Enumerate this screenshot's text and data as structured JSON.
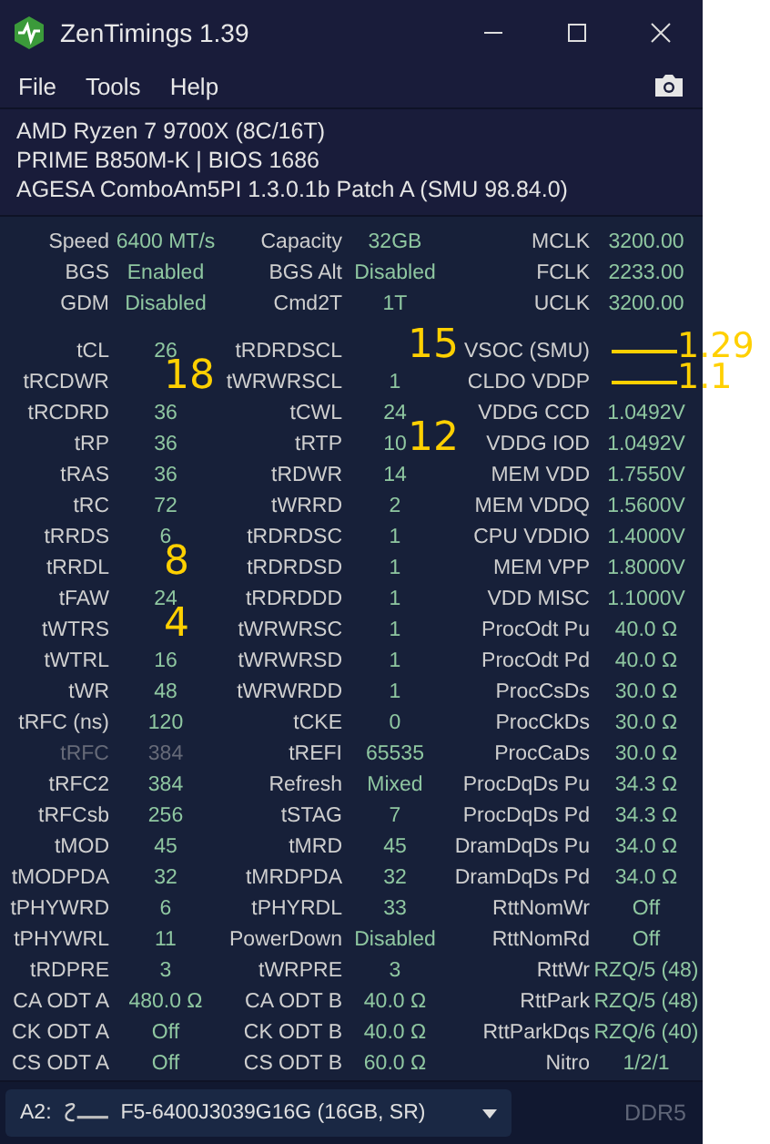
{
  "window": {
    "title": "ZenTimings 1.39"
  },
  "menu": [
    "File",
    "Tools",
    "Help"
  ],
  "system_info": [
    "AMD Ryzen 7 9700X (8C/16T)",
    "PRIME B850M-K | BIOS 1686",
    "AGESA ComboAm5PI 1.3.0.1b Patch A (SMU 98.84.0)"
  ],
  "summary": [
    [
      {
        "label": "Speed",
        "value": "6400 MT/s"
      },
      {
        "label": "Capacity",
        "value": "32GB"
      },
      {
        "label": "MCLK",
        "value": "3200.00"
      }
    ],
    [
      {
        "label": "BGS",
        "value": "Enabled"
      },
      {
        "label": "BGS Alt",
        "value": "Disabled"
      },
      {
        "label": "FCLK",
        "value": "2233.00"
      }
    ],
    [
      {
        "label": "GDM",
        "value": "Disabled"
      },
      {
        "label": "Cmd2T",
        "value": "1T"
      },
      {
        "label": "UCLK",
        "value": "3200.00"
      }
    ]
  ],
  "timings": [
    [
      {
        "label": "tCL",
        "value": "26"
      },
      {
        "label": "tRDRDSCL",
        "annotation": "15"
      },
      {
        "label": "VSOC (SMU)",
        "struck": true,
        "annotation": "1.29"
      }
    ],
    [
      {
        "label": "tRCDWR",
        "annotation": "18"
      },
      {
        "label": "tWRWRSCL",
        "value": "1"
      },
      {
        "label": "CLDO VDDP",
        "struck": true,
        "annotation": "1.1"
      }
    ],
    [
      {
        "label": "tRCDRD",
        "value": "36"
      },
      {
        "label": "tCWL",
        "value": "24"
      },
      {
        "label": "VDDG CCD",
        "value": "1.0492V"
      }
    ],
    [
      {
        "label": "tRP",
        "value": "36"
      },
      {
        "label": "tRTP",
        "value": "10",
        "annotation": "12"
      },
      {
        "label": "VDDG IOD",
        "value": "1.0492V"
      }
    ],
    [
      {
        "label": "tRAS",
        "value": "36"
      },
      {
        "label": "tRDWR",
        "value": "14"
      },
      {
        "label": "MEM VDD",
        "value": "1.7550V"
      }
    ],
    [
      {
        "label": "tRC",
        "value": "72"
      },
      {
        "label": "tWRRD",
        "value": "2"
      },
      {
        "label": "MEM VDDQ",
        "value": "1.5600V"
      }
    ],
    [
      {
        "label": "tRRDS",
        "value": "6"
      },
      {
        "label": "tRDRDSC",
        "value": "1"
      },
      {
        "label": "CPU VDDIO",
        "value": "1.4000V"
      }
    ],
    [
      {
        "label": "tRRDL",
        "annotation": "8"
      },
      {
        "label": "tRDRDSD",
        "value": "1"
      },
      {
        "label": "MEM VPP",
        "value": "1.8000V"
      }
    ],
    [
      {
        "label": "tFAW",
        "value": "24"
      },
      {
        "label": "tRDRDDD",
        "value": "1"
      },
      {
        "label": "VDD MISC",
        "value": "1.1000V"
      }
    ],
    [
      {
        "label": "tWTRS",
        "annotation": "4"
      },
      {
        "label": "tWRWRSC",
        "value": "1"
      },
      {
        "label": "ProcOdt Pu",
        "value": "40.0 Ω"
      }
    ],
    [
      {
        "label": "tWTRL",
        "value": "16"
      },
      {
        "label": "tWRWRSD",
        "value": "1"
      },
      {
        "label": "ProcOdt Pd",
        "value": "40.0 Ω"
      }
    ],
    [
      {
        "label": "tWR",
        "value": "48"
      },
      {
        "label": "tWRWRDD",
        "value": "1"
      },
      {
        "label": "ProcCsDs",
        "value": "30.0 Ω"
      }
    ],
    [
      {
        "label": "tRFC (ns)",
        "value": "120"
      },
      {
        "label": "tCKE",
        "value": "0"
      },
      {
        "label": "ProcCkDs",
        "value": "30.0 Ω"
      }
    ],
    [
      {
        "label": "tRFC",
        "value": "384",
        "disabled": true
      },
      {
        "label": "tREFI",
        "value": "65535"
      },
      {
        "label": "ProcCaDs",
        "value": "30.0 Ω"
      }
    ],
    [
      {
        "label": "tRFC2",
        "value": "384"
      },
      {
        "label": "Refresh",
        "value": "Mixed"
      },
      {
        "label": "ProcDqDs Pu",
        "value": "34.3 Ω"
      }
    ],
    [
      {
        "label": "tRFCsb",
        "value": "256"
      },
      {
        "label": "tSTAG",
        "value": "7"
      },
      {
        "label": "ProcDqDs Pd",
        "value": "34.3 Ω"
      }
    ],
    [
      {
        "label": "tMOD",
        "value": "45"
      },
      {
        "label": "tMRD",
        "value": "45"
      },
      {
        "label": "DramDqDs Pu",
        "value": "34.0 Ω"
      }
    ],
    [
      {
        "label": "tMODPDA",
        "value": "32"
      },
      {
        "label": "tMRDPDA",
        "value": "32"
      },
      {
        "label": "DramDqDs Pd",
        "value": "34.0 Ω"
      }
    ],
    [
      {
        "label": "tPHYWRD",
        "value": "6"
      },
      {
        "label": "tPHYRDL",
        "value": "33"
      },
      {
        "label": "RttNomWr",
        "value": "Off"
      }
    ],
    [
      {
        "label": "tPHYWRL",
        "value": "11"
      },
      {
        "label": "PowerDown",
        "value": "Disabled"
      },
      {
        "label": "RttNomRd",
        "value": "Off"
      }
    ],
    [
      {
        "label": "tRDPRE",
        "value": "3"
      },
      {
        "label": "tWRPRE",
        "value": "3"
      },
      {
        "label": "RttWr",
        "value": "RZQ/5 (48)"
      }
    ],
    [
      {
        "label": "CA ODT A",
        "value": "480.0 Ω"
      },
      {
        "label": "CA ODT B",
        "value": "40.0 Ω"
      },
      {
        "label": "RttPark",
        "value": "RZQ/5 (48)"
      }
    ],
    [
      {
        "label": "CK ODT A",
        "value": "Off"
      },
      {
        "label": "CK ODT B",
        "value": "40.0 Ω"
      },
      {
        "label": "RttParkDqs",
        "value": "RZQ/6 (40)"
      }
    ],
    [
      {
        "label": "CS ODT A",
        "value": "Off"
      },
      {
        "label": "CS ODT B",
        "value": "60.0 Ω"
      },
      {
        "label": "Nitro",
        "value": "1/2/1"
      }
    ]
  ],
  "module": {
    "slot": "A2:",
    "name": "F5-6400J3039G16G (16GB, SR)",
    "type": "DDR5"
  }
}
